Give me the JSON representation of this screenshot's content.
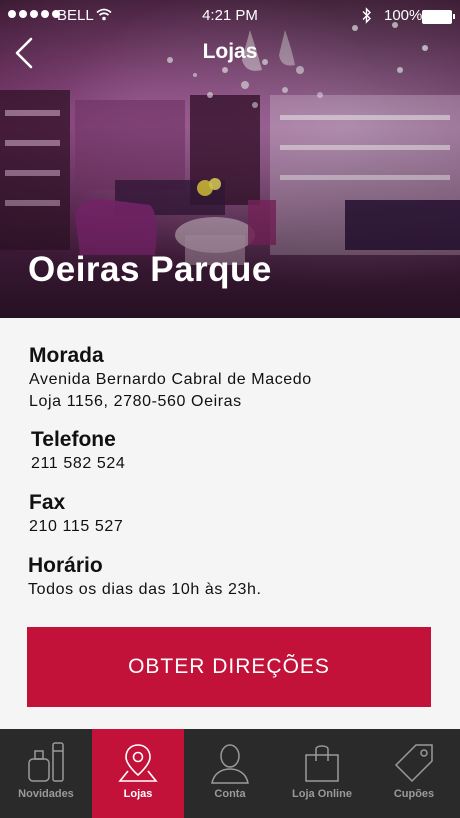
{
  "status_bar": {
    "carrier": "BELL",
    "time": "4:21 PM",
    "battery": "100%"
  },
  "header": {
    "title": "Lojas",
    "back_icon": "chevron-left-icon"
  },
  "store": {
    "name": "Oeiras Parque"
  },
  "details": {
    "address_label": "Morada",
    "address_line1": "Avenida Bernardo Cabral de Macedo",
    "address_line2": "Loja 1156, 2780-560 Oeiras",
    "phone_label": "Telefone",
    "phone": "211 582 524",
    "fax_label": "Fax",
    "fax": "210 115 527",
    "hours_label": "Horário",
    "hours": "Todos os dias das 10h às 23h."
  },
  "directions_button": "OBTER DIREÇÕES",
  "tabs": [
    {
      "label": "Novidades",
      "icon": "perfume-icon"
    },
    {
      "label": "Lojas",
      "icon": "map-pin-icon"
    },
    {
      "label": "Conta",
      "icon": "user-icon"
    },
    {
      "label": "Loja Online",
      "icon": "shopping-bag-icon"
    },
    {
      "label": "Cupões",
      "icon": "tag-icon"
    }
  ],
  "colors": {
    "accent": "#c2123a",
    "tabbar": "#2a2a2a"
  }
}
